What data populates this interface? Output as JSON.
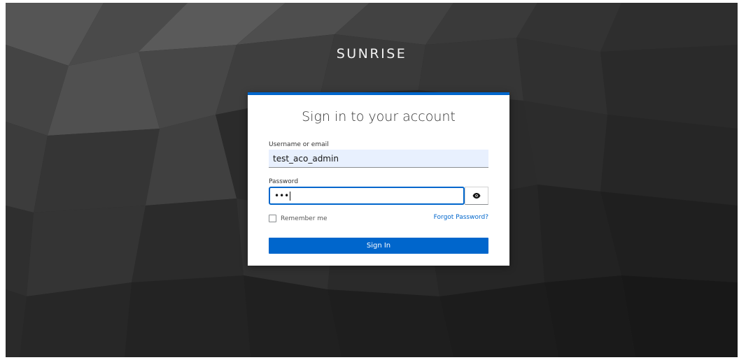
{
  "brand": {
    "title": "SUNRISE"
  },
  "login": {
    "heading": "Sign in to your account",
    "username_label": "Username or email",
    "username_value": "test_aco_admin",
    "password_label": "Password",
    "password_value": "•••",
    "remember_label": "Remember me",
    "forgot_label": "Forgot Password?",
    "submit_label": "Sign In",
    "show_password_icon": "eye-icon"
  },
  "colors": {
    "accent": "#0066cc",
    "background": "#2a2a2a",
    "username_fill": "#e8f0fe"
  }
}
